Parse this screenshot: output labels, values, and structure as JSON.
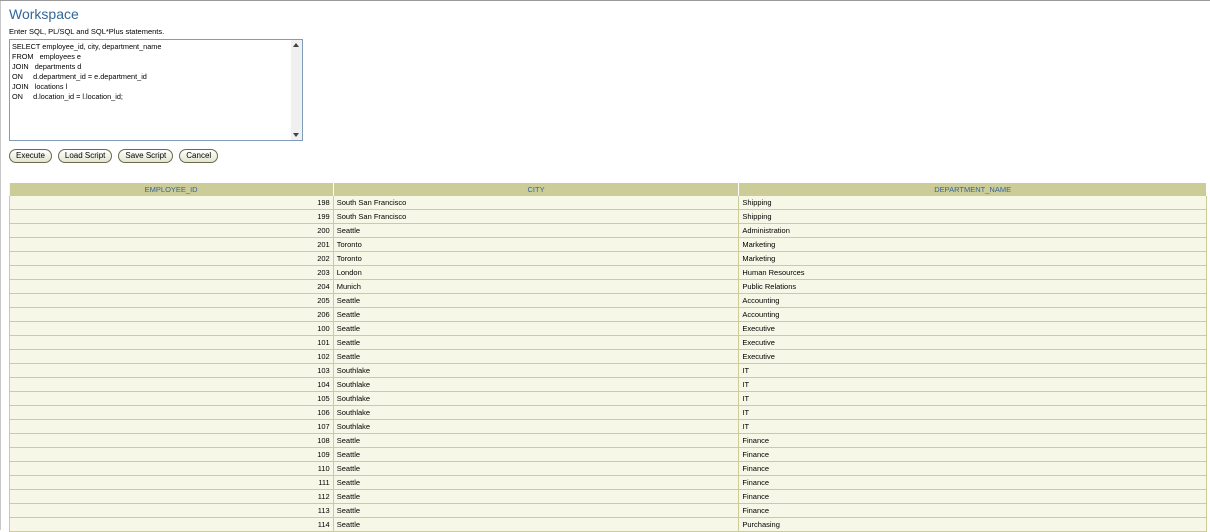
{
  "workspace": {
    "title": "Workspace",
    "instructions": "Enter SQL, PL/SQL and SQL*Plus statements.",
    "sql_text": "SELECT employee_id, city, department_name\nFROM   employees e\nJOIN   departments d\nON     d.department_id = e.department_id\nJOIN   locations l\nON     d.location_id = l.location_id;"
  },
  "buttons": {
    "execute": "Execute",
    "load_script": "Load Script",
    "save_script": "Save Script",
    "cancel": "Cancel"
  },
  "results": {
    "columns": [
      "EMPLOYEE_ID",
      "CITY",
      "DEPARTMENT_NAME"
    ],
    "rows": [
      [
        "198",
        "South San Francisco",
        "Shipping"
      ],
      [
        "199",
        "South San Francisco",
        "Shipping"
      ],
      [
        "200",
        "Seattle",
        "Administration"
      ],
      [
        "201",
        "Toronto",
        "Marketing"
      ],
      [
        "202",
        "Toronto",
        "Marketing"
      ],
      [
        "203",
        "London",
        "Human Resources"
      ],
      [
        "204",
        "Munich",
        "Public Relations"
      ],
      [
        "205",
        "Seattle",
        "Accounting"
      ],
      [
        "206",
        "Seattle",
        "Accounting"
      ],
      [
        "100",
        "Seattle",
        "Executive"
      ],
      [
        "101",
        "Seattle",
        "Executive"
      ],
      [
        "102",
        "Seattle",
        "Executive"
      ],
      [
        "103",
        "Southlake",
        "IT"
      ],
      [
        "104",
        "Southlake",
        "IT"
      ],
      [
        "105",
        "Southlake",
        "IT"
      ],
      [
        "106",
        "Southlake",
        "IT"
      ],
      [
        "107",
        "Southlake",
        "IT"
      ],
      [
        "108",
        "Seattle",
        "Finance"
      ],
      [
        "109",
        "Seattle",
        "Finance"
      ],
      [
        "110",
        "Seattle",
        "Finance"
      ],
      [
        "111",
        "Seattle",
        "Finance"
      ],
      [
        "112",
        "Seattle",
        "Finance"
      ],
      [
        "113",
        "Seattle",
        "Finance"
      ],
      [
        "114",
        "Seattle",
        "Purchasing"
      ]
    ]
  },
  "colors": {
    "header_bg": "#cccc99",
    "header_text": "#336699",
    "row_bg": "#f7f7e7",
    "title": "#336699"
  }
}
